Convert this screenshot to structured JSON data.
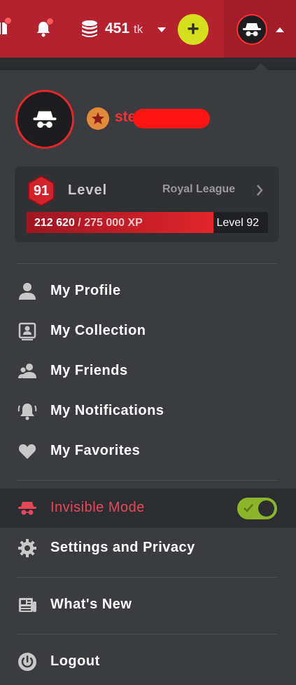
{
  "topbar": {
    "balance_value": "451",
    "balance_unit": "tk",
    "add_label": "+"
  },
  "profile": {
    "username": "ste"
  },
  "level": {
    "number": "91",
    "label": "Level",
    "league": "Royal League",
    "xp_current": "212 620",
    "xp_separator": " / ",
    "xp_total": "275 000 XP",
    "xp_progress": 0.773,
    "next_level": "Level 92"
  },
  "menu": {
    "profile": "My Profile",
    "collection": "My Collection",
    "friends": "My Friends",
    "notifications": "My Notifications",
    "favorites": "My Favorites",
    "invisible": "Invisible Mode",
    "invisible_on": true,
    "settings": "Settings and Privacy",
    "whats_new": "What's New",
    "logout": "Logout"
  },
  "colors": {
    "brand_red": "#b3222d",
    "accent_lime": "#d4e01e",
    "toggle_on": "#8db52a",
    "invisible_text": "#e8475a"
  },
  "icons": {
    "gift": "gift-icon",
    "bell": "bell-icon",
    "coins": "coins-icon",
    "spy": "incognito-icon",
    "user": "user-icon",
    "collection": "id-card-icon",
    "friends": "friends-icon",
    "notifications": "bell-ring-icon",
    "favorites": "heart-icon",
    "settings": "gear-icon",
    "news": "newspaper-icon",
    "logout": "power-icon"
  }
}
